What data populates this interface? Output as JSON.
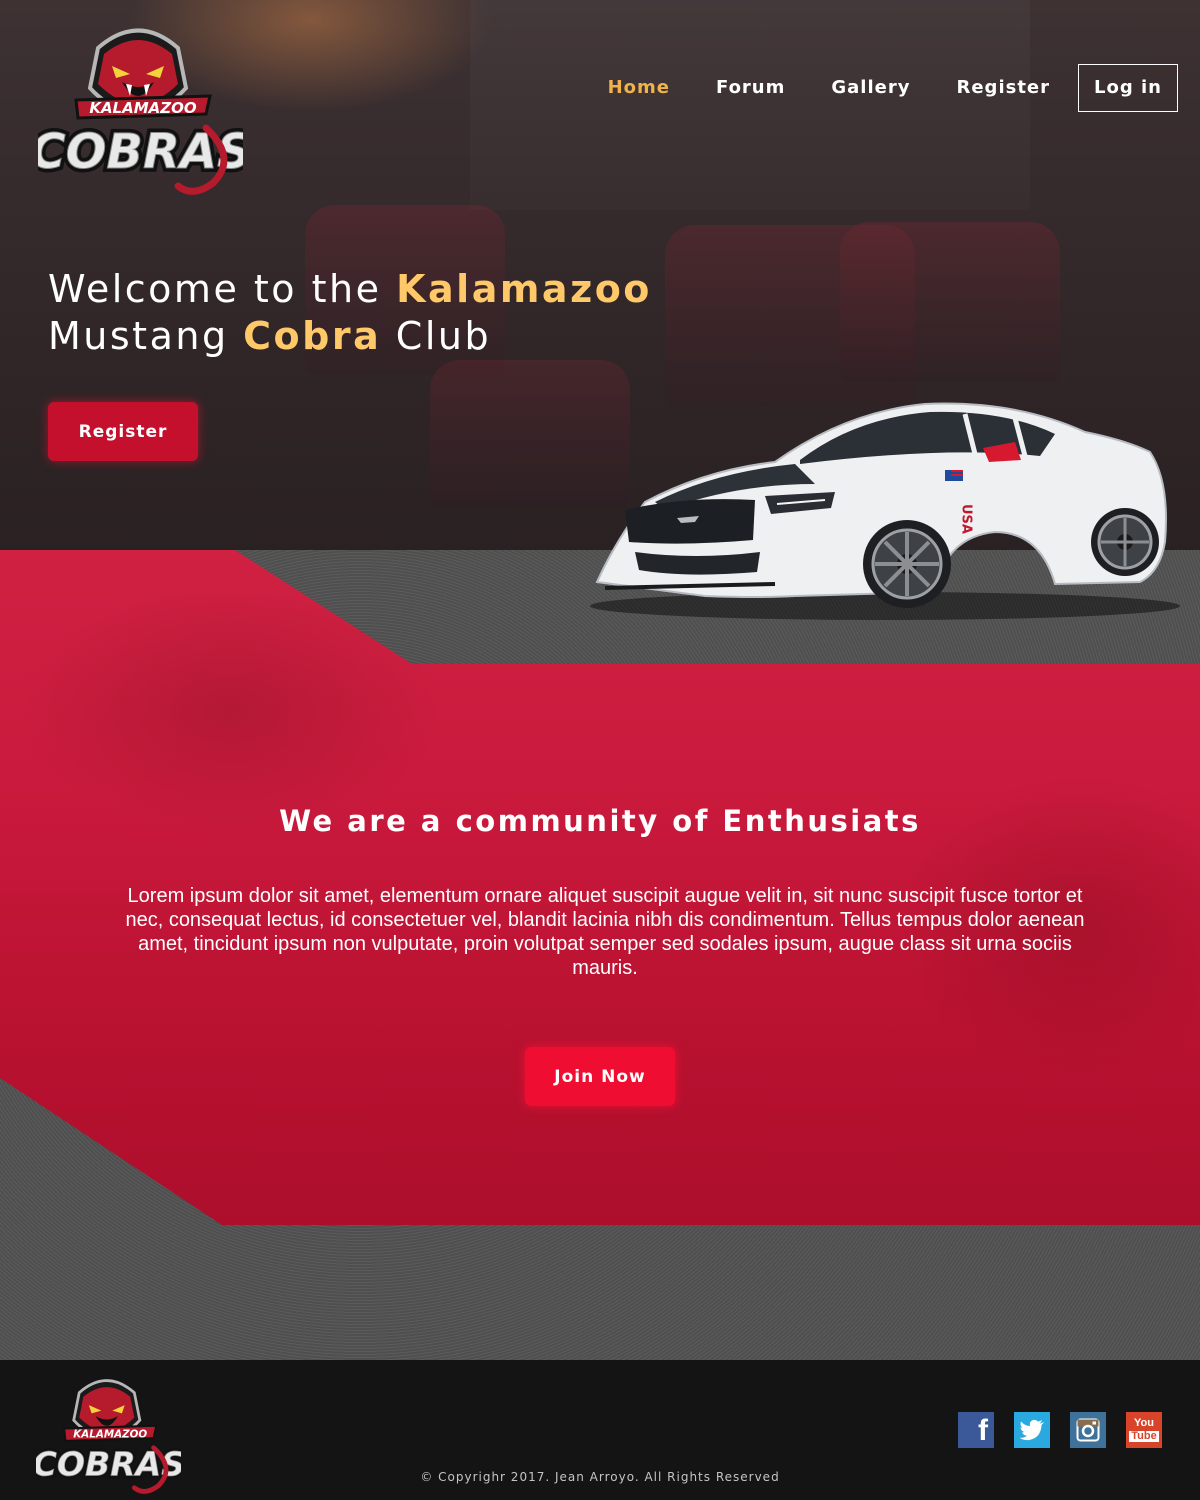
{
  "brand": {
    "logo_top": "KALAMAZOO",
    "logo_main": "COBRAS"
  },
  "nav": {
    "items": [
      {
        "label": "Home",
        "active": true
      },
      {
        "label": "Forum",
        "active": false
      },
      {
        "label": "Gallery",
        "active": false
      },
      {
        "label": "Register",
        "active": false
      }
    ],
    "login_label": "Log in"
  },
  "hero": {
    "line1_prefix": "Welcome to the ",
    "line1_highlight": "Kalamazoo",
    "line2_prefix": "Mustang ",
    "line2_highlight": "Cobra",
    "line2_suffix": " Club",
    "register_label": "Register",
    "car_badge": "USA"
  },
  "community": {
    "title_1": "We are a ",
    "title_bold_1": "community",
    "title_2": " of ",
    "title_bold_2": "Enthusiats",
    "body": "Lorem ipsum dolor sit amet, elementum ornare aliquet suscipit augue velit in, sit nunc suscipit fusce tortor et nec, consequat lectus, id consectetuer vel, blandit lacinia nibh dis condimentum. Tellus tempus dolor aenean amet, tincidunt ipsum non vulputate, proin volutpat semper sed sodales ipsum, augue class sit urna sociis mauris.",
    "join_label": "Join Now"
  },
  "footer": {
    "socials": [
      {
        "name": "facebook",
        "glyph": "f"
      },
      {
        "name": "twitter",
        "glyph": ""
      },
      {
        "name": "instagram",
        "glyph": ""
      },
      {
        "name": "youtube",
        "glyph_top": "You",
        "glyph_bottom": "Tube"
      }
    ],
    "copyright": "© Copyrighr 2017. Jean Arroyo. All Rights Reserved"
  },
  "colors": {
    "accent_gold": "#f0b24a",
    "highlight_gold": "#ffc868",
    "brand_red": "#c4102d",
    "join_red": "#ef0d32",
    "band_red": "#c9193c"
  }
}
